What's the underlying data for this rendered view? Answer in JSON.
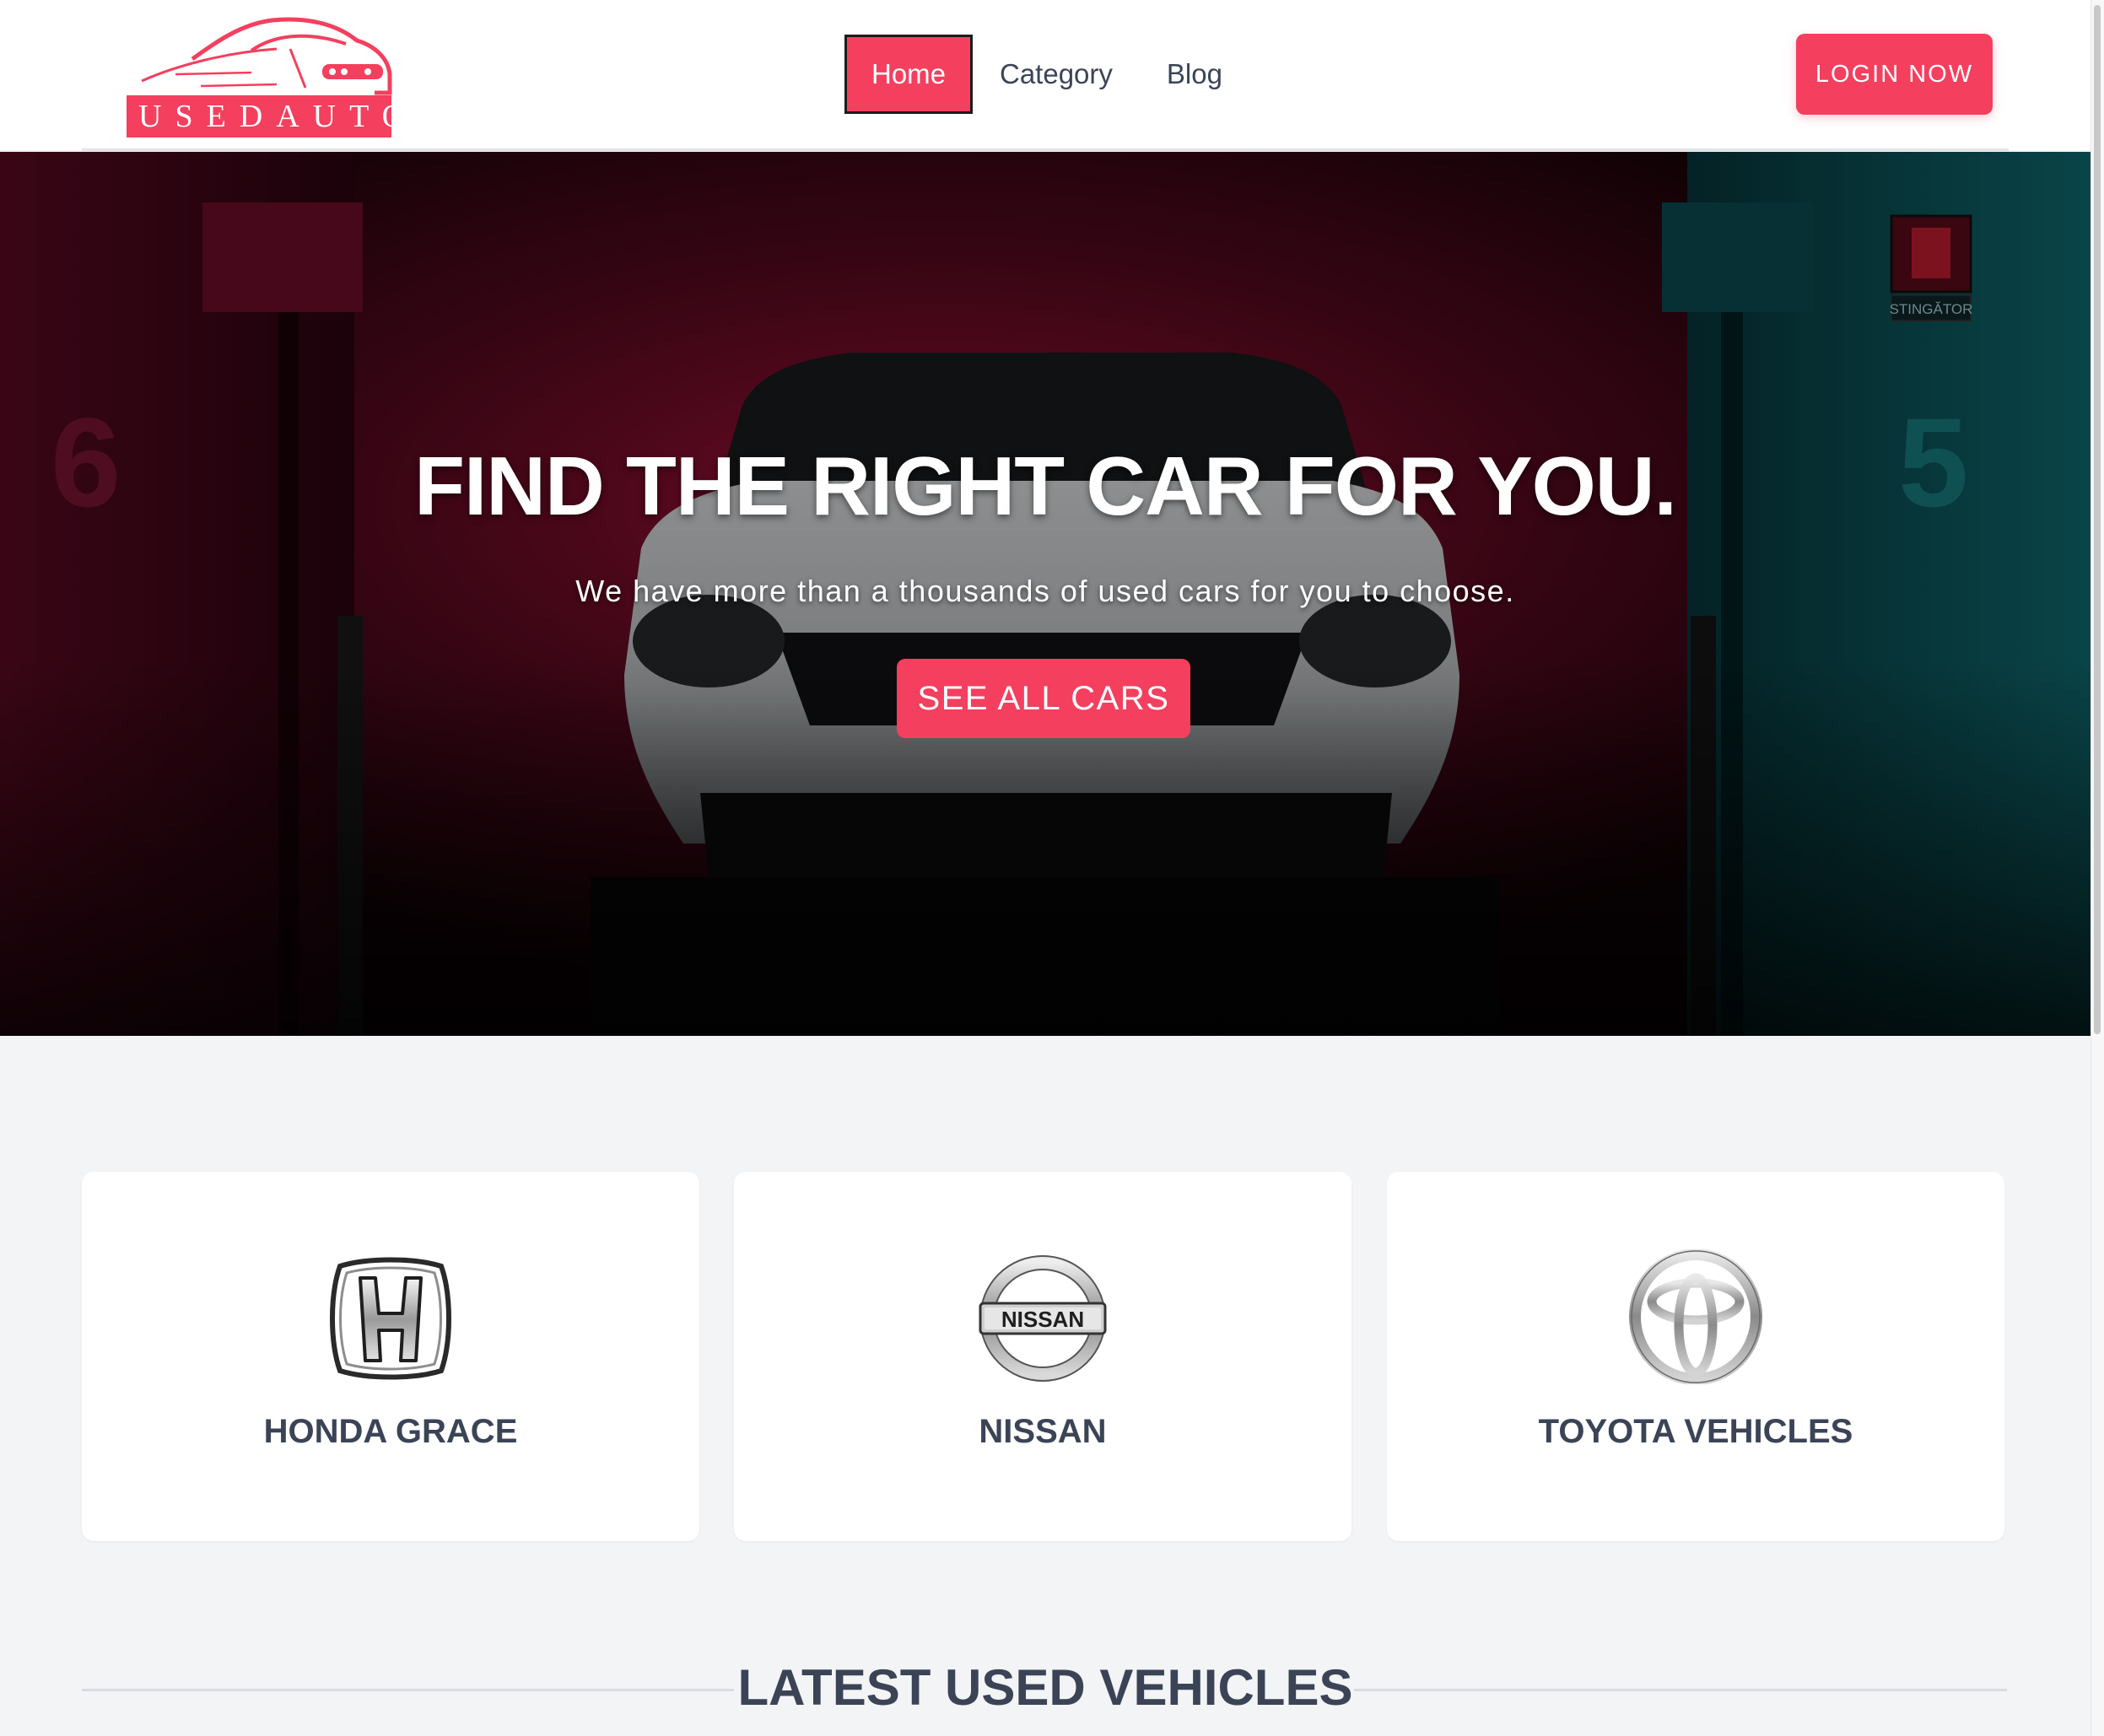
{
  "header": {
    "logo_text": "USEDAUTO",
    "nav": [
      {
        "label": "Home",
        "active": true
      },
      {
        "label": "Category",
        "active": false
      },
      {
        "label": "Blog",
        "active": false
      }
    ],
    "login_label": "LOGIN NOW"
  },
  "hero": {
    "title": "FIND THE RIGHT CAR FOR YOU.",
    "subtitle": "We have more than a thousands of used cars for you to choose.",
    "cta_label": "SEE ALL CARS",
    "background_image": "white SUV front view in dark garage lit red and teal",
    "sign_text": "STINGĂTOR",
    "left_pillar_number": "6",
    "right_pillar_number": "5"
  },
  "brands": [
    {
      "name": "HONDA GRACE",
      "icon": "honda-logo-icon"
    },
    {
      "name": "NISSAN",
      "icon": "nissan-logo-icon",
      "badge_text": "NISSAN"
    },
    {
      "name": "TOYOTA VEHICLES",
      "icon": "toyota-logo-icon"
    }
  ],
  "latest": {
    "title": "LATEST USED VEHICLES"
  },
  "colors": {
    "accent": "#f43f5e",
    "text": "#3b4457",
    "page_bg": "#f3f4f6",
    "card_bg": "#ffffff"
  }
}
